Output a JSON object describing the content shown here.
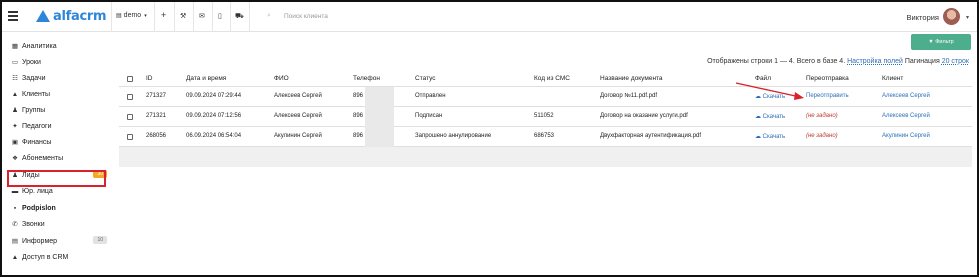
{
  "app": {
    "logo_text": "alfacrm"
  },
  "topbar": {
    "branch": "demo",
    "branch_caret": "▾",
    "plus": "+",
    "wrench": "⚒",
    "mail": "✉",
    "phone": "▯",
    "cart": "⛟",
    "search_placeholder": "Поиск клиента",
    "user_name": "Виктория",
    "user_caret": "▾"
  },
  "sidebar": {
    "items": [
      {
        "label": "Аналитика",
        "icon": "chart-icon",
        "glyph": "▦"
      },
      {
        "label": "Уроки",
        "icon": "lessons-icon",
        "glyph": "▭"
      },
      {
        "label": "Задачи",
        "icon": "tasks-icon",
        "glyph": "☷"
      },
      {
        "label": "Клиенты",
        "icon": "clients-icon",
        "glyph": "▲"
      },
      {
        "label": "Группы",
        "icon": "groups-icon",
        "glyph": "♟"
      },
      {
        "label": "Педагоги",
        "icon": "teachers-icon",
        "glyph": "✦"
      },
      {
        "label": "Финансы",
        "icon": "finance-icon",
        "glyph": "▣"
      },
      {
        "label": "Абонементы",
        "icon": "subscriptions-icon",
        "glyph": "❖"
      },
      {
        "label": "Лиды",
        "icon": "leads-icon",
        "glyph": "♟",
        "badge": "30",
        "badge_style": "orange"
      },
      {
        "label": "Юр. лица",
        "icon": "legal-entities-icon",
        "glyph": "▬"
      },
      {
        "label": "Podpislon",
        "icon": "document-icon",
        "glyph": "▪"
      },
      {
        "label": "Звонки",
        "icon": "calls-icon",
        "glyph": "✆"
      },
      {
        "label": "Информер",
        "icon": "informer-icon",
        "glyph": "▤",
        "badge": "10",
        "badge_style": "grey"
      },
      {
        "label": "Доступ в CRM",
        "icon": "lock-icon",
        "glyph": "▲"
      }
    ]
  },
  "toolbar": {
    "filter_label": "▼ Фильтр",
    "info_prefix": "Отображены строки 1 — 4. Всего в базе 4.",
    "columns_link": "Настройка полей",
    "pagination_label": "Пагинация",
    "pagination_value": "20 строк"
  },
  "table": {
    "columns": [
      "ID",
      "Дата и время",
      "ФИО",
      "Телефон",
      "Статус",
      "Код из СМС",
      "Название документа",
      "Файл",
      "Переотправка",
      "Клиент"
    ],
    "rows": [
      {
        "id": "271327",
        "datetime": "09.09.2024 07:29:44",
        "fio": "Алексеев Сергей",
        "phone": "896",
        "status": "Отправлен",
        "sms": "",
        "doc": "Договор №11.pdf.pdf",
        "file": "☁ Скачать",
        "resend": "Переотправить",
        "resend_style": "link",
        "client": "Алексеев Сергей"
      },
      {
        "id": "271321",
        "datetime": "09.09.2024 07:12:56",
        "fio": "Алексеев Сергей",
        "phone": "896",
        "status": "Подписан",
        "sms": "511052",
        "doc": "Договор на оказание услуги.pdf",
        "file": "☁ Скачать",
        "resend": "(не задано)",
        "resend_style": "muted",
        "client": "Алексеев Сергей"
      },
      {
        "id": "268056",
        "datetime": "06.09.2024 06:54:04",
        "fio": "Акулинин Сергей",
        "phone": "896",
        "status": "Запрошено аннулирование",
        "sms": "686753",
        "doc": "Двухфакторная аутентификация.pdf",
        "file": "☁ Скачать",
        "resend": "(не задано)",
        "resend_style": "muted",
        "client": "Акулинин Сергей"
      }
    ]
  },
  "colors": {
    "accent": "#2e86d9",
    "filter": "#4cae8d",
    "highlight": "#d8232a",
    "link": "#2c6fb7"
  }
}
